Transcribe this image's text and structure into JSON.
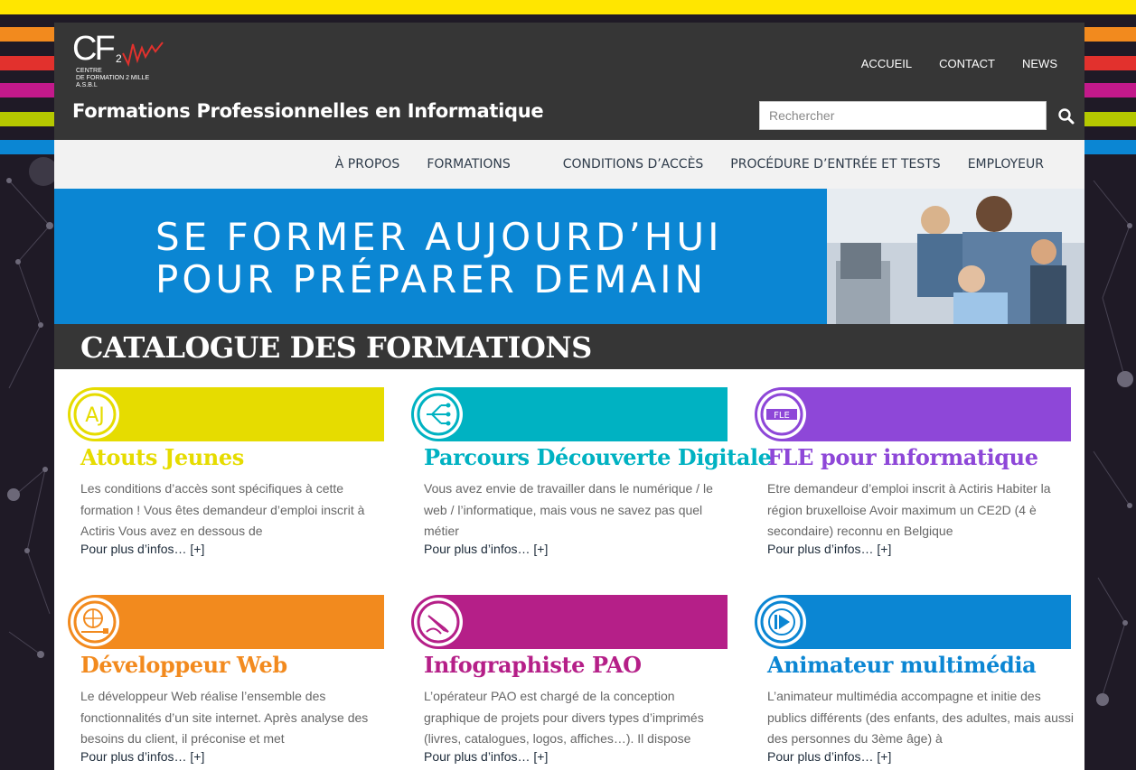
{
  "brand": {
    "logo_text": "CF",
    "logo_sub_lines": [
      "CENTRE",
      "DE FORMATION 2 MILLE",
      "A.S.B.L"
    ],
    "tagline": "Formations Professionnelles en Informatique"
  },
  "top_nav": [
    "ACCUEIL",
    "CONTACT",
    "NEWS"
  ],
  "search": {
    "placeholder": "Rechercher"
  },
  "main_nav": [
    "À PROPOS",
    "FORMATIONS",
    "CONDITIONS D’ACCÈS",
    "PROCÉDURE D’ENTRÉE ET TESTS",
    "EMPLOYEUR"
  ],
  "banner": {
    "line1": "SE FORMER AUJOURD’HUI",
    "line2": "POUR PRÉPARER DEMAIN"
  },
  "catalogue_title": "CATALOGUE DES FORMATIONS",
  "courses": [
    {
      "title": "Atouts Jeunes",
      "color": "#e6dc00",
      "icon": "aj-logo-icon",
      "desc": "Les conditions d’accès sont spécifiques à cette formation ! Vous êtes demandeur d’emploi inscrit à Actiris Vous avez en dessous de",
      "more": "Pour plus d’infos… [+]"
    },
    {
      "title": "Parcours Découverte Digitale",
      "color": "#00b2c2",
      "icon": "circuit-icon",
      "desc": "Vous avez envie de travailler dans le numérique / le web / l’informatique, mais vous ne savez pas quel métier",
      "more": "Pour plus d’infos… [+]"
    },
    {
      "title": "FLE pour informatique",
      "color": "#8e47d8",
      "icon": "fle-icon",
      "desc": "Etre demandeur d’emploi inscrit à Actiris Habiter la région bruxelloise Avoir maximum un CE2D (4 è secondaire) reconnu en Belgique",
      "more": "Pour plus d’infos… [+]"
    },
    {
      "title": "Développeur Web",
      "color": "#f28a1e",
      "icon": "globe-network-icon",
      "desc": "Le développeur Web réalise l’ensemble des fonctionnalités d’un site internet. Après analyse des besoins du client, il préconise et met",
      "more": "Pour plus d’infos… [+]"
    },
    {
      "title": "Infographiste PAO",
      "color": "#b51f88",
      "icon": "pen-icon",
      "desc": "L’opérateur PAO est chargé de la conception graphique de projets pour divers types d’imprimés (livres, catalogues, logos, affiches…). Il dispose",
      "more": "Pour plus d’infos… [+]"
    },
    {
      "title": "Animateur multimédia",
      "color": "#0b86d3",
      "icon": "play-icon",
      "desc": "L’animateur multimédia accompagne et initie des publics différents (des enfants, des adultes, mais aussi des personnes du 3ème âge) à",
      "more": "Pour plus d’infos… [+]"
    }
  ]
}
